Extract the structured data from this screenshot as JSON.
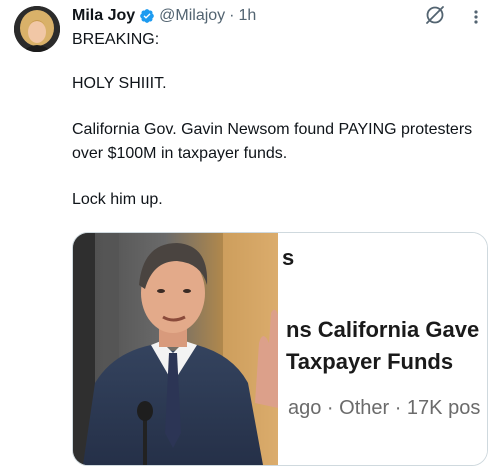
{
  "tweet": {
    "author_name": "Mila Joy",
    "author_handle": "@Milajoy",
    "separator": "·",
    "time": "1h",
    "lines": [
      "BREAKING:",
      "HOLY SHIIIT.",
      "California Gov. Gavin Newsom found PAYING protesters over $100M in taxpayer funds.",
      "Lock him up."
    ]
  },
  "icons": {
    "verified": "verified-badge-icon",
    "grok": "grok-icon",
    "more": "more-options-icon"
  },
  "card": {
    "snippet_top": "s",
    "headline_line1": "ns California Gave",
    "headline_line2": "Taxpayer Funds",
    "meta": "ago · Other · 17K pos"
  },
  "colors": {
    "verified_blue": "#1d9bf0",
    "text_secondary": "#536471",
    "text_primary": "#0f1419",
    "border": "#cfd9de"
  }
}
